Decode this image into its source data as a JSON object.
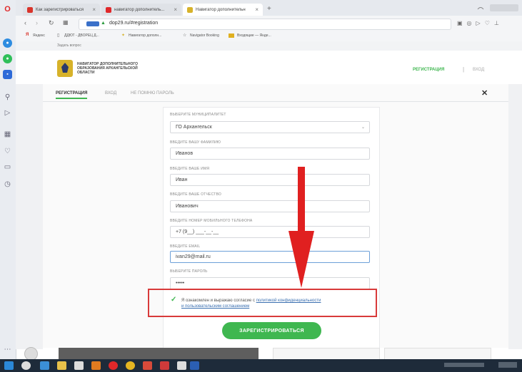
{
  "browser": {
    "tabs": [
      {
        "label": "Как зарегистрироваться",
        "fav_color": "#d9342b"
      },
      {
        "label": "навигатор дополнитель...",
        "fav_color": "#e0282a"
      },
      {
        "label": "Навигатор дополнительн",
        "fav_color": "#d7b22a"
      }
    ],
    "new_tab": "+",
    "url": "dop29.ru/#registration",
    "bookmarks": [
      "Яндекс",
      "ДДЮТ - ДВОРЕЦ Д...",
      "Навигатор дополн...",
      "Navigator Booking",
      "Входящие — Янде..."
    ],
    "ask_question": "Задать вопрос"
  },
  "site": {
    "org_name_line1": "НАВИГАТОР ДОПОЛНИТЕЛЬНОГО",
    "org_name_line2": "ОБРАЗОВАНИЯ АРХАНГЕЛЬСКОЙ",
    "org_name_line3": "ОБЛАСТИ",
    "nav_register": "РЕГИСТРАЦИЯ",
    "nav_separator": "|",
    "nav_login": "ВХОД"
  },
  "modal": {
    "tabs": [
      "РЕГИСТРАЦИЯ",
      "ВХОД",
      "НЕ ПОМНЮ ПАРОЛЬ"
    ],
    "close": "✕"
  },
  "form": {
    "fields": [
      {
        "label": "ВЫБЕРИТЕ МУНИЦИПАЛИТЕТ",
        "value": "ГО Архангельск",
        "type": "select"
      },
      {
        "label": "ВВЕДИТЕ ВАШУ ФАМИЛИЮ",
        "value": "Иванов"
      },
      {
        "label": "ВВЕДИТЕ ВАШЕ ИМЯ",
        "value": "Иван"
      },
      {
        "label": "ВВЕДИТЕ ВАШЕ ОТЧЕСТВО",
        "value": "Иванович"
      },
      {
        "label": "ВВЕДИТЕ НОМЕР МОБИЛЬНОГО ТЕЛЕФОНА",
        "value": "+7 (9__) ___-__-__"
      },
      {
        "label": "ВВЕДИТЕ EMAIL",
        "value": "ivan29@mail.ru"
      },
      {
        "label": "ВЫБЕРИТЕ ПАРОЛЬ",
        "value": "•••••"
      }
    ],
    "agree_text": "Я ознакомлен и выражаю согласие с",
    "agree_link1": "политикой конфиденциальности",
    "agree_link2": "и пользовательским соглашением",
    "submit": "ЗАРЕГИСТРИРОВАТЬСЯ"
  },
  "colors": {
    "accent_green": "#3fb750",
    "annotation_red": "#d83a3a"
  }
}
